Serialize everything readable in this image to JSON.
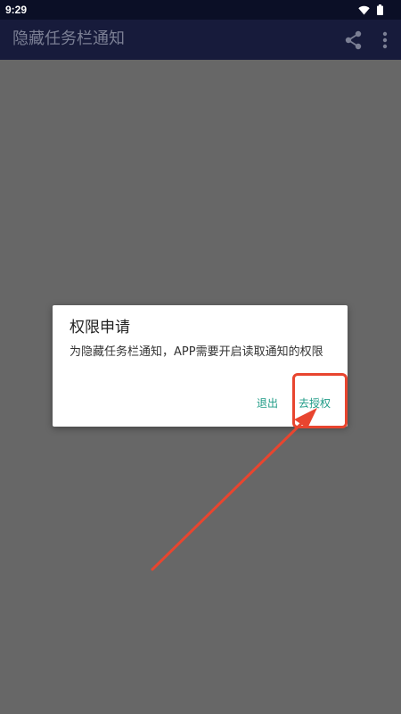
{
  "status_bar": {
    "time": "9:29",
    "icons": [
      "wifi-icon",
      "battery-icon"
    ]
  },
  "app_bar": {
    "title": "隐藏任务栏通知",
    "actions": [
      "share-icon",
      "more-vert-icon"
    ]
  },
  "dialog": {
    "title": "权限申请",
    "message": "为隐藏任务栏通知，APP需要开启读取通知的权限",
    "buttons": {
      "exit": "退出",
      "authorize": "去授权"
    }
  },
  "colors": {
    "status_bar": "#0b0f26",
    "app_bar": "#171b3b",
    "scrim": "#676767",
    "dialog_accent": "#1e9b86",
    "annotation": "#e8452f"
  }
}
